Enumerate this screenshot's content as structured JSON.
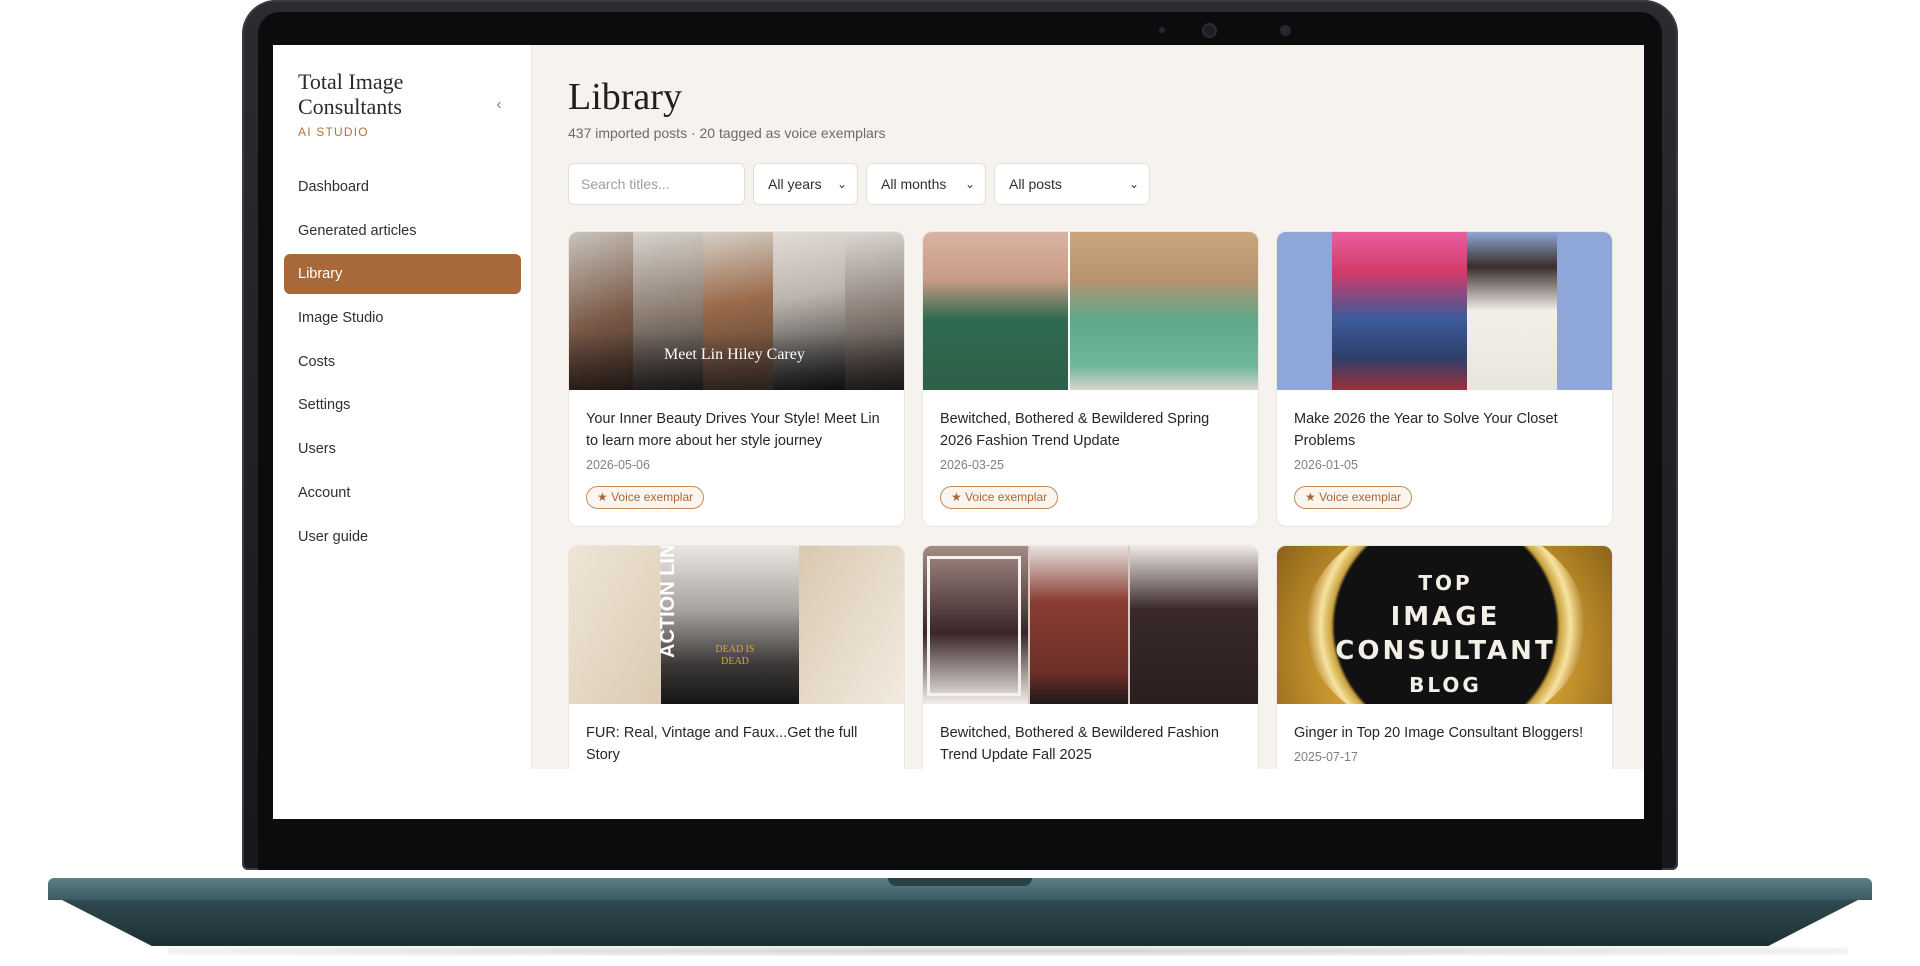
{
  "app": {
    "brand_title": "Total Image Consultants",
    "brand_subtitle": "AI STUDIO",
    "collapse_icon": "‹"
  },
  "sidebar": {
    "items": [
      {
        "label": "Dashboard",
        "active": false
      },
      {
        "label": "Generated articles",
        "active": false
      },
      {
        "label": "Library",
        "active": true
      },
      {
        "label": "Image Studio",
        "active": false
      },
      {
        "label": "Costs",
        "active": false
      },
      {
        "label": "Settings",
        "active": false
      },
      {
        "label": "Users",
        "active": false
      },
      {
        "label": "Account",
        "active": false
      },
      {
        "label": "User guide",
        "active": false
      }
    ]
  },
  "page": {
    "title": "Library",
    "subtitle": "437 imported posts · 20 tagged as voice exemplars"
  },
  "filters": {
    "search_placeholder": "Search titles...",
    "year": "All years",
    "month": "All months",
    "posts": "All posts",
    "chevron": "⌄"
  },
  "posts": [
    {
      "title": "Your Inner Beauty Drives Your Style! Meet Lin to learn more about her style journey",
      "date": "2026-05-06",
      "badge": "★ Voice exemplar",
      "image_text": "Meet Lin Hiley Carey"
    },
    {
      "title": "Bewitched, Bothered & Bewildered Spring 2026 Fashion Trend Update",
      "date": "2026-03-25",
      "badge": "★ Voice exemplar"
    },
    {
      "title": "Make 2026 the Year to Solve Your Closet Problems",
      "date": "2026-01-05",
      "badge": "★ Voice exemplar"
    },
    {
      "title": "FUR: Real, Vintage and Faux...Get the full Story",
      "image_text_1": "ACTION LINE",
      "image_text_2": "DEAD IS DEAD"
    },
    {
      "title": "Bewitched, Bothered & Bewildered Fashion Trend Update Fall 2025"
    },
    {
      "title": "Ginger in Top 20 Image Consultant Bloggers!",
      "date": "2025-07-17",
      "image_lines": [
        "TOP",
        "IMAGE",
        "CONSULTANT",
        "BLOG"
      ]
    }
  ],
  "colors": {
    "accent": "#a7693a",
    "main_bg": "#f6f2ee",
    "laptop_base": "#3b5a61"
  }
}
